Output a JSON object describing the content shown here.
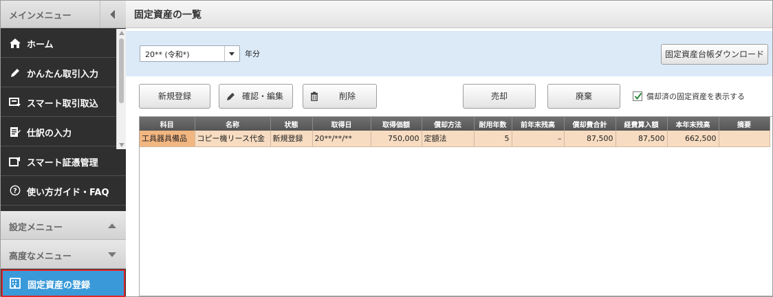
{
  "sidebar": {
    "title": "メインメニュー",
    "items": [
      {
        "label": "ホーム",
        "icon": "home-icon"
      },
      {
        "label": "かんたん取引入力",
        "icon": "pencil-icon"
      },
      {
        "label": "スマート取引取込",
        "icon": "import-icon"
      },
      {
        "label": "仕訳の入力",
        "icon": "journal-icon"
      },
      {
        "label": "スマート証憑管理",
        "icon": "document-icon"
      },
      {
        "label": "使い方ガイド・FAQ",
        "icon": "help-icon"
      }
    ],
    "settings_menu": "設定メニュー",
    "advanced_menu": "高度なメニュー",
    "active_item": "固定資産の登録"
  },
  "main": {
    "title": "固定資産の一覧",
    "year_select": {
      "value": "20** (令和*)",
      "suffix": "年分"
    },
    "download_button": "固定資産台帳ダウンロード",
    "buttons": {
      "new": "新規登録",
      "edit": "確認・編集",
      "delete": "削除",
      "sell": "売却",
      "dispose": "廃棄"
    },
    "show_depreciated": {
      "label": "償却済の固定資産を表示する",
      "checked": true
    }
  },
  "table": {
    "headers": [
      "科目",
      "名称",
      "状態",
      "取得日",
      "取得価額",
      "償却方法",
      "耐用年数",
      "前年末残高",
      "償却費合計",
      "経費算入額",
      "本年末残高",
      "摘要"
    ],
    "rows": [
      [
        "工具器具備品",
        "コピー機リース代金",
        "新規登録",
        "20**/**/**",
        "750,000",
        "定額法",
        "5",
        "–",
        "87,500",
        "87,500",
        "662,500",
        ""
      ]
    ]
  },
  "colors": {
    "sidebar_bg": "#2f2f2f",
    "active_item_bg": "#3a9ad9",
    "active_item_border": "#e0262a",
    "filter_bar_bg": "#dceaf8",
    "selected_row_bg": "#f7dcc1"
  }
}
